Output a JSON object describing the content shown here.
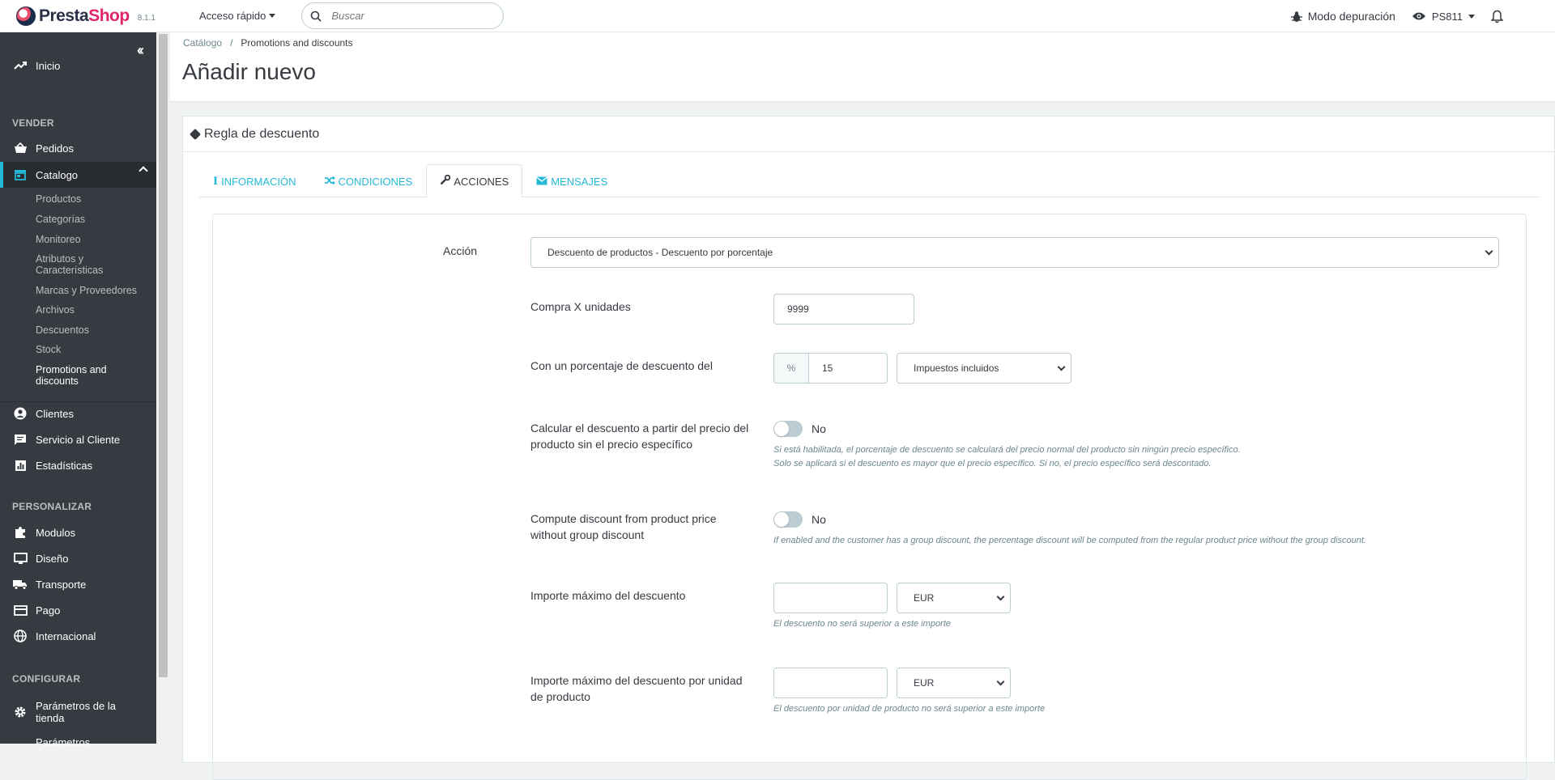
{
  "header": {
    "brand_presta": "Presta",
    "brand_shop": "Shop",
    "version": "8.1.1",
    "quick_access": "Acceso rápido",
    "search_placeholder": "Buscar",
    "debug_mode": "Modo depuración",
    "shop_name": "PS811"
  },
  "sidebar": {
    "home": "Inicio",
    "section_sell": "VENDER",
    "orders": "Pedidos",
    "catalog": "Catalogo",
    "catalog_sub": [
      "Productos",
      "Categorías",
      "Monitoreo",
      "Atributos y Características",
      "Marcas y Proveedores",
      "Archivos",
      "Descuentos",
      "Stock",
      "Promotions and discounts"
    ],
    "customers": "Clientes",
    "customer_service": "Servicio al Cliente",
    "stats": "Estadísticas",
    "section_customize": "PERSONALIZAR",
    "modules": "Modulos",
    "design": "Diseño",
    "shipping": "Transporte",
    "payment": "Pago",
    "international": "Internacional",
    "section_configure": "CONFIGURAR",
    "shop_params": "Parámetros de la tienda",
    "advanced_params": "Parámetros"
  },
  "breadcrumb": {
    "parent": "Catálogo",
    "separator": "/",
    "current": "Promotions and discounts"
  },
  "page_title": "Añadir nuevo",
  "panel_title": "Regla de descuento",
  "tabs": [
    {
      "label": "Información"
    },
    {
      "label": "Condiciones"
    },
    {
      "label": "Acciones"
    },
    {
      "label": "Mensajes"
    }
  ],
  "form": {
    "action_label": "Acción",
    "action_value": "Descuento de productos - Descuento por porcentaje",
    "buy_x_label": "Compra X unidades",
    "buy_x_value": "9999",
    "percent_label": "Con un porcentaje de descuento del",
    "percent_addon": "%",
    "percent_value": "15",
    "tax_value": "Impuestos incluidos",
    "calc_label": "Calcular el descuento a partir del precio del producto sin el precio específico",
    "calc_toggle": "No",
    "calc_help_1": "Si está habilitada, el porcentaje de descuento se calculará del precio normal del producto sin ningún precio específico.",
    "calc_help_2": "Solo se aplicará si el descuento es mayor que el precio específico. Si no, el precio específico será descontado.",
    "group_label": "Compute discount from product price without group discount",
    "group_toggle": "No",
    "group_help": "If enabled and the customer has a group discount, the percentage discount will be computed from the regular product price without the group discount.",
    "max_label": "Importe máximo del descuento",
    "max_currency": "EUR",
    "max_help": "El descuento no será superior a este importe",
    "max_unit_label": "Importe máximo del descuento por unidad de producto",
    "max_unit_currency": "EUR",
    "max_unit_help": "El descuento por unidad de producto no será superior a este importe"
  }
}
